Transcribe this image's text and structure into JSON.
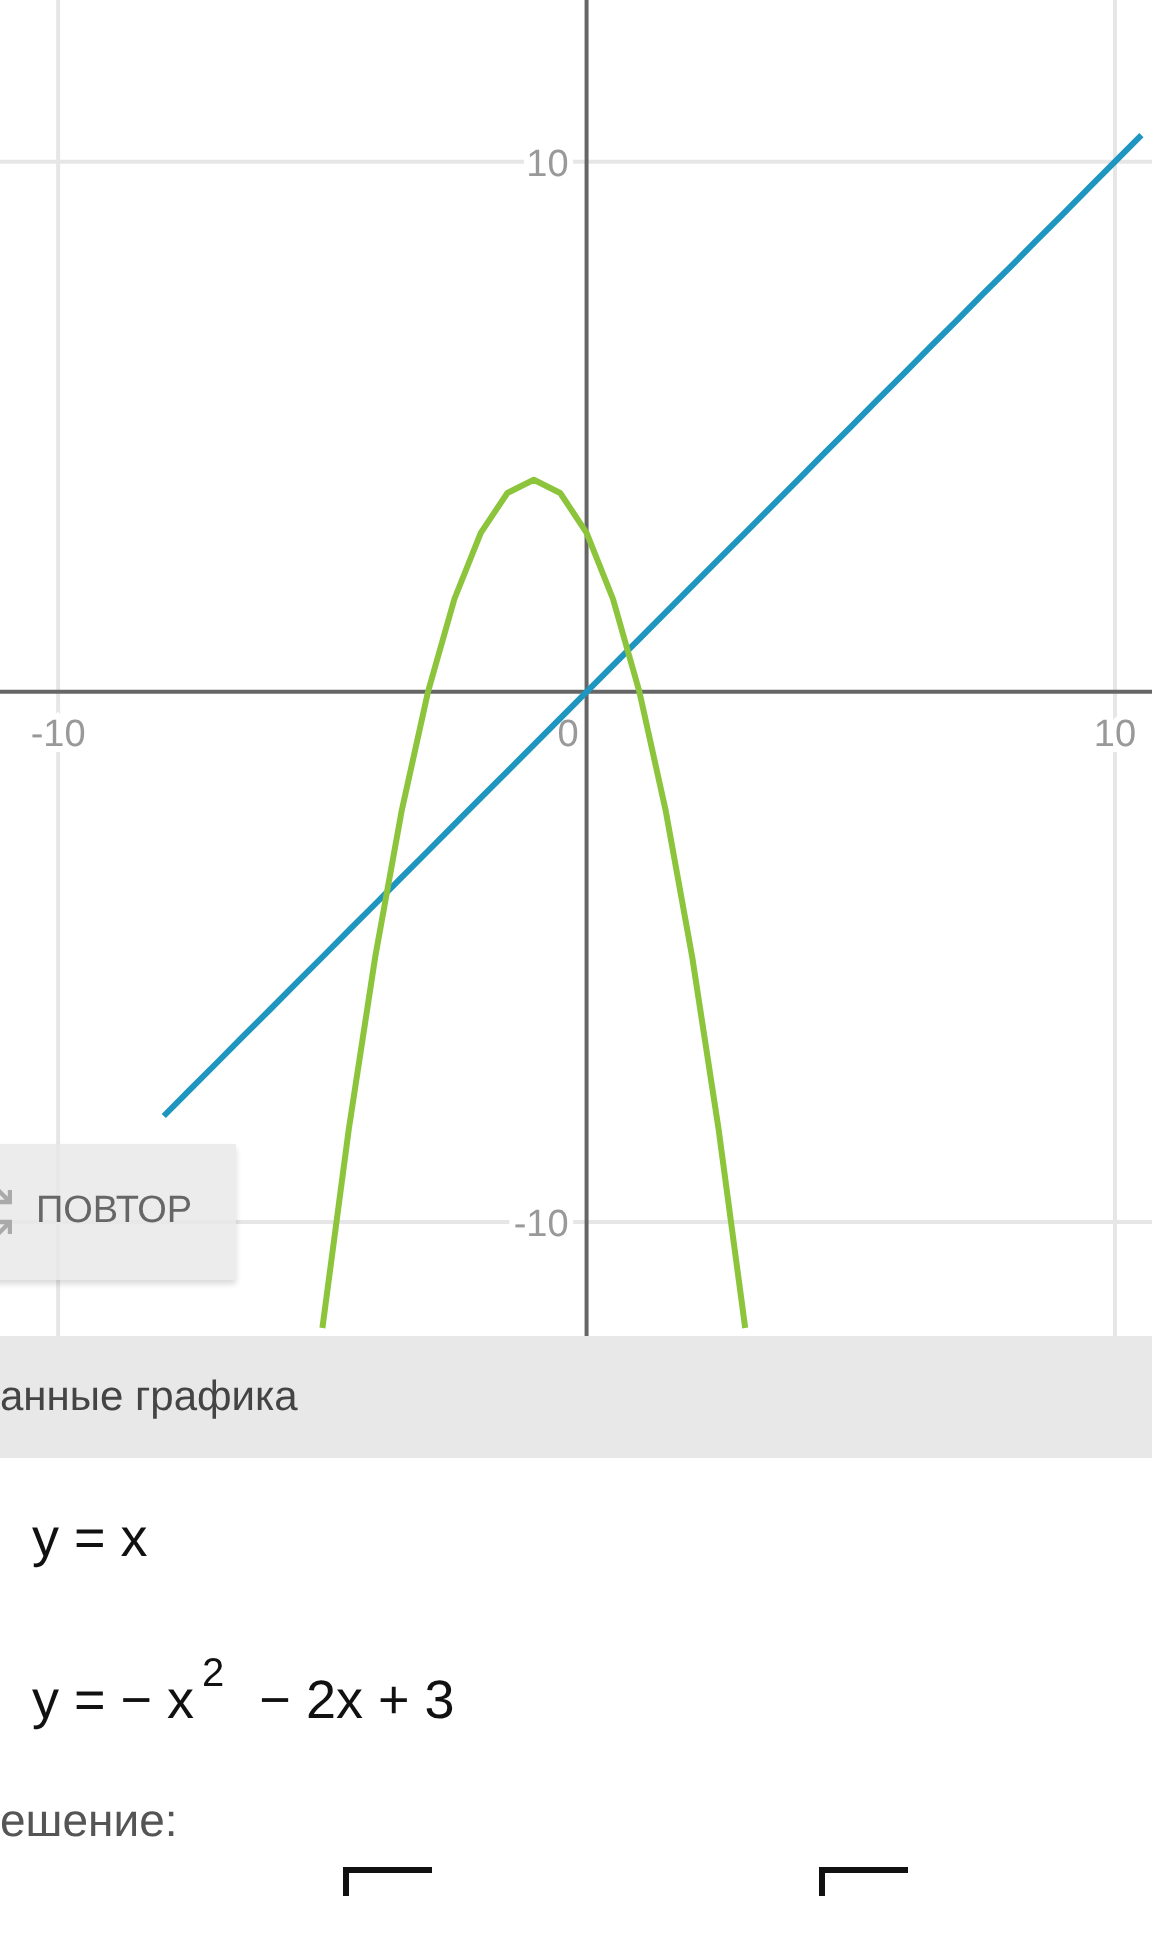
{
  "chart": {
    "chart_data": {
      "type": "line",
      "grid": true,
      "x": [
        -8,
        -7.5,
        -7,
        -6.5,
        -6,
        -5.5,
        -5,
        -4.5,
        -4,
        -3.5,
        -3,
        -2.5,
        -2,
        -1.5,
        -1,
        -0.5,
        0,
        0.5,
        1,
        1.5,
        2,
        2.5,
        3,
        3.5,
        4,
        4.5,
        5,
        5.5,
        6,
        6.5,
        7,
        7.5,
        8,
        8.5,
        9,
        9.5,
        10,
        10.5
      ],
      "xlim": [
        -11.1,
        10.7
      ],
      "ylim": [
        -12.15,
        13.05
      ],
      "xticks": [
        -10,
        0,
        10
      ],
      "yticks": [
        -10,
        10
      ],
      "series": [
        {
          "name": "y = x",
          "color": "#1e96c0",
          "values": [
            -8,
            -7.5,
            -7,
            -6.5,
            -6,
            -5.5,
            -5,
            -4.5,
            -4,
            -3.5,
            -3,
            -2.5,
            -2,
            -1.5,
            -1,
            -0.5,
            0,
            0.5,
            1,
            1.5,
            2,
            2.5,
            3,
            3.5,
            4,
            4.5,
            5,
            5.5,
            6,
            6.5,
            7,
            7.5,
            8,
            8.5,
            9,
            9.5,
            10,
            10.5
          ]
        },
        {
          "name": "y = − x$^{2}$ − 2x + 3",
          "color": "#8cc43c",
          "values": [
            null,
            null,
            null,
            null,
            null,
            null,
            -12,
            -8.25,
            -5,
            -2.25,
            0,
            1.75,
            3,
            3.75,
            4,
            3.75,
            3,
            1.75,
            0,
            -2.25,
            -5,
            -8.25,
            -12,
            null,
            null,
            null,
            null,
            null,
            null,
            null,
            null,
            null,
            null,
            null,
            null,
            null,
            null,
            null
          ]
        }
      ]
    }
  },
  "repeat_button": {
    "label": "ПОВТОР"
  },
  "graph_data": {
    "title": "анные графика"
  },
  "solution": {
    "label": "ешение:"
  }
}
